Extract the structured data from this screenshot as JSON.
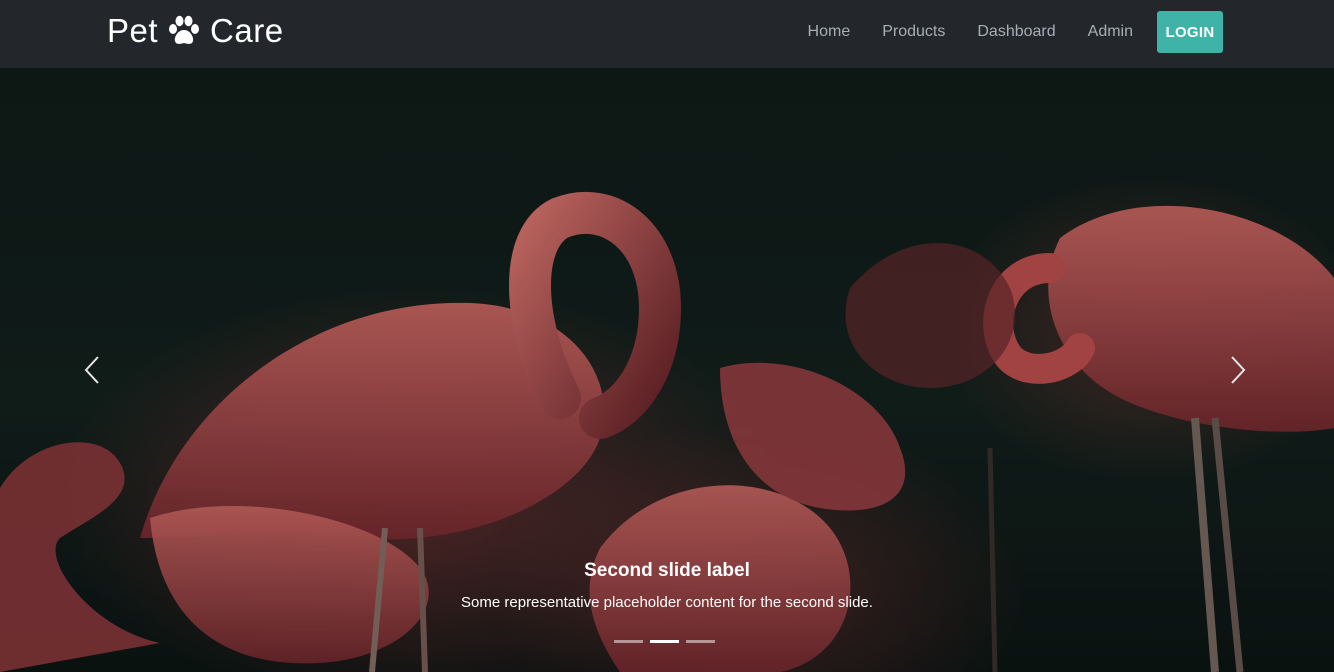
{
  "navbar": {
    "brand_left": "Pet",
    "brand_right": "Care",
    "brand_icon": "paw-icon",
    "links": [
      "Home",
      "Products",
      "Dashboard",
      "Admin"
    ],
    "login_label": "LOGIN",
    "login_color": "#3fb3a8"
  },
  "carousel": {
    "caption_title": "Second slide label",
    "caption_text": "Some representative placeholder content for the second slide.",
    "indicators_count": 3,
    "active_index": 1,
    "prev_icon": "chevron-left-icon",
    "next_icon": "chevron-right-icon"
  }
}
